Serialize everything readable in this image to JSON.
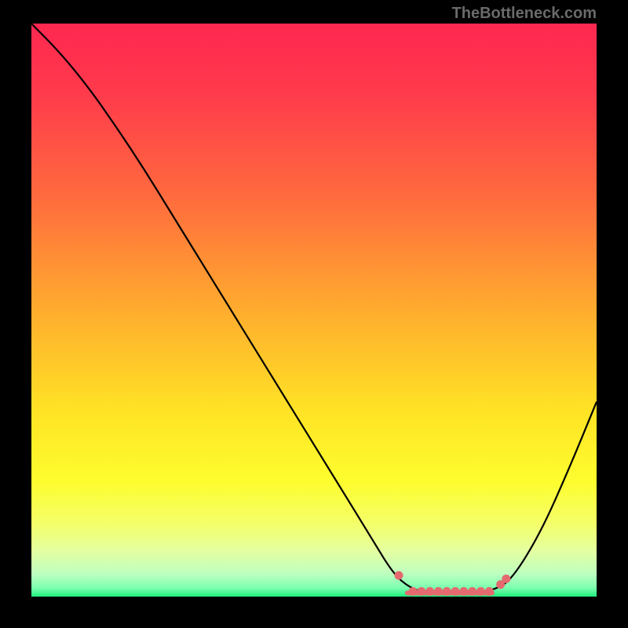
{
  "watermark": "TheBottleneck.com",
  "chart_data": {
    "type": "line",
    "title": "",
    "xlabel": "",
    "ylabel": "",
    "xlim": [
      0,
      100
    ],
    "ylim": [
      0,
      100
    ],
    "gradient_stops": [
      {
        "offset": 0.0,
        "color": "#ff2850"
      },
      {
        "offset": 0.12,
        "color": "#ff3a4c"
      },
      {
        "offset": 0.3,
        "color": "#ff6a3e"
      },
      {
        "offset": 0.5,
        "color": "#ffac2e"
      },
      {
        "offset": 0.68,
        "color": "#ffe425"
      },
      {
        "offset": 0.8,
        "color": "#fdfd2e"
      },
      {
        "offset": 0.87,
        "color": "#f5ff66"
      },
      {
        "offset": 0.92,
        "color": "#e4ffa0"
      },
      {
        "offset": 0.96,
        "color": "#beffc0"
      },
      {
        "offset": 0.985,
        "color": "#7bffaf"
      },
      {
        "offset": 1.0,
        "color": "#1fef7d"
      }
    ],
    "series": [
      {
        "name": "bottleneck-curve",
        "points": [
          {
            "x": 0,
            "y": 100
          },
          {
            "x": 5,
            "y": 95
          },
          {
            "x": 10,
            "y": 89
          },
          {
            "x": 15,
            "y": 82
          },
          {
            "x": 20,
            "y": 74.5
          },
          {
            "x": 25,
            "y": 66.5
          },
          {
            "x": 30,
            "y": 58.5
          },
          {
            "x": 35,
            "y": 50.5
          },
          {
            "x": 40,
            "y": 42.5
          },
          {
            "x": 45,
            "y": 34.5
          },
          {
            "x": 50,
            "y": 26.5
          },
          {
            "x": 55,
            "y": 18.5
          },
          {
            "x": 60,
            "y": 10.5
          },
          {
            "x": 64,
            "y": 4.0
          },
          {
            "x": 67,
            "y": 1.5
          },
          {
            "x": 70,
            "y": 0.6
          },
          {
            "x": 74,
            "y": 0.4
          },
          {
            "x": 78,
            "y": 0.5
          },
          {
            "x": 82,
            "y": 1.2
          },
          {
            "x": 85,
            "y": 3.0
          },
          {
            "x": 90,
            "y": 11
          },
          {
            "x": 95,
            "y": 22
          },
          {
            "x": 100,
            "y": 34
          }
        ]
      }
    ],
    "flat_region": {
      "x_start": 65,
      "x_end": 84,
      "y": 0.9,
      "dot_xs": [
        65,
        67.5,
        69,
        70.5,
        72,
        73.5,
        75,
        76.5,
        78,
        79.5,
        81,
        83,
        84
      ]
    }
  }
}
